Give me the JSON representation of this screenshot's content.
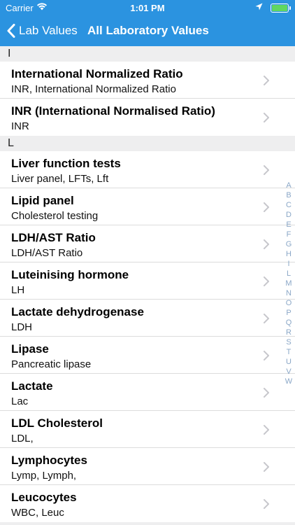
{
  "status_bar": {
    "carrier": "Carrier",
    "time": "1:01 PM",
    "battery_color": "#60d760"
  },
  "nav": {
    "back_label": "Lab Values",
    "title": "All Laboratory Values",
    "bar_color": "#2b93e0"
  },
  "sections": [
    {
      "header": "I",
      "rows": [
        {
          "title": "International Normalized Ratio",
          "subtitle": "INR, International Normalized Ratio"
        },
        {
          "title": "INR (International Normalised Ratio)",
          "subtitle": "INR"
        }
      ]
    },
    {
      "header": "L",
      "rows": [
        {
          "title": "Liver function tests",
          "subtitle": "Liver panel, LFTs, Lft"
        },
        {
          "title": "Lipid panel",
          "subtitle": "Cholesterol testing"
        },
        {
          "title": "LDH/AST Ratio",
          "subtitle": "LDH/AST Ratio"
        },
        {
          "title": "Luteinising hormone",
          "subtitle": "LH"
        },
        {
          "title": "Lactate dehydrogenase",
          "subtitle": "LDH"
        },
        {
          "title": "Lipase",
          "subtitle": "Pancreatic lipase"
        },
        {
          "title": "Lactate",
          "subtitle": "Lac"
        },
        {
          "title": "LDL Cholesterol",
          "subtitle": "LDL,"
        },
        {
          "title": "Lymphocytes",
          "subtitle": "Lymp, Lymph,"
        },
        {
          "title": "Leucocytes",
          "subtitle": "WBC, Leuc"
        }
      ]
    }
  ],
  "index_letters": [
    "A",
    "B",
    "C",
    "D",
    "E",
    "F",
    "G",
    "H",
    "I",
    "L",
    "M",
    "N",
    "O",
    "P",
    "Q",
    "R",
    "S",
    "T",
    "U",
    "V",
    "W"
  ]
}
